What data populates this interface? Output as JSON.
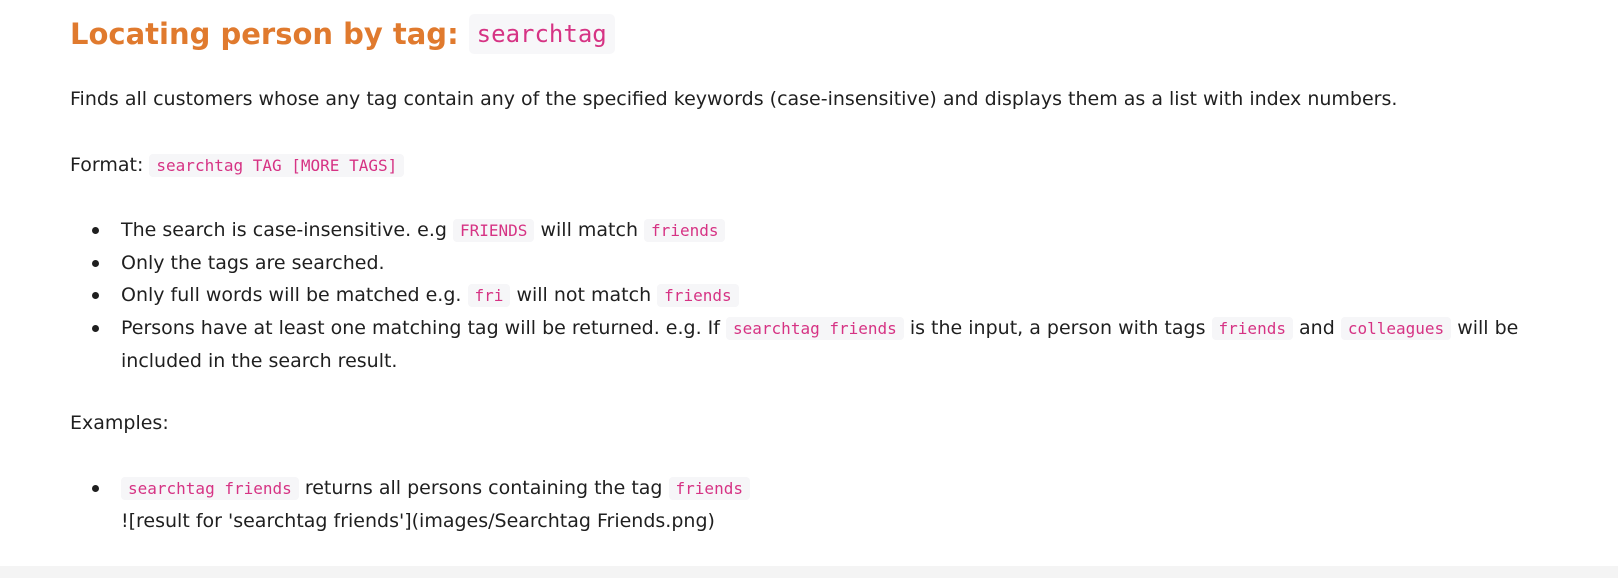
{
  "heading": {
    "text": "Locating person by tag:",
    "code": "searchtag"
  },
  "description": "Finds all customers whose any tag contain any of the specified keywords (case-insensitive) and displays them as a list with index numbers.",
  "format": {
    "label": "Format:",
    "code": "searchtag TAG [MORE TAGS]"
  },
  "rules": {
    "item1": {
      "text_a": "The search is case-insensitive. e.g",
      "code_a": "FRIENDS",
      "text_b": "will match",
      "code_b": "friends"
    },
    "item2": {
      "text": "Only the tags are searched."
    },
    "item3": {
      "text_a": "Only full words will be matched e.g.",
      "code_a": "fri",
      "text_b": "will not match",
      "code_b": "friends"
    },
    "item4": {
      "text_a": "Persons have at least one matching tag will be returned. e.g. If",
      "code_a": "searchtag friends",
      "text_b": "is the input, a person with tags",
      "code_b": "friends",
      "text_c": "and",
      "code_c": "colleagues",
      "text_d": "will be included in the search result."
    }
  },
  "examples": {
    "label": "Examples:",
    "item1": {
      "code_a": "searchtag friends",
      "text_a": "returns all persons containing the tag",
      "code_b": "friends",
      "image_text": "![result for 'searchtag friends'](images/Searchtag Friends.png)"
    }
  }
}
